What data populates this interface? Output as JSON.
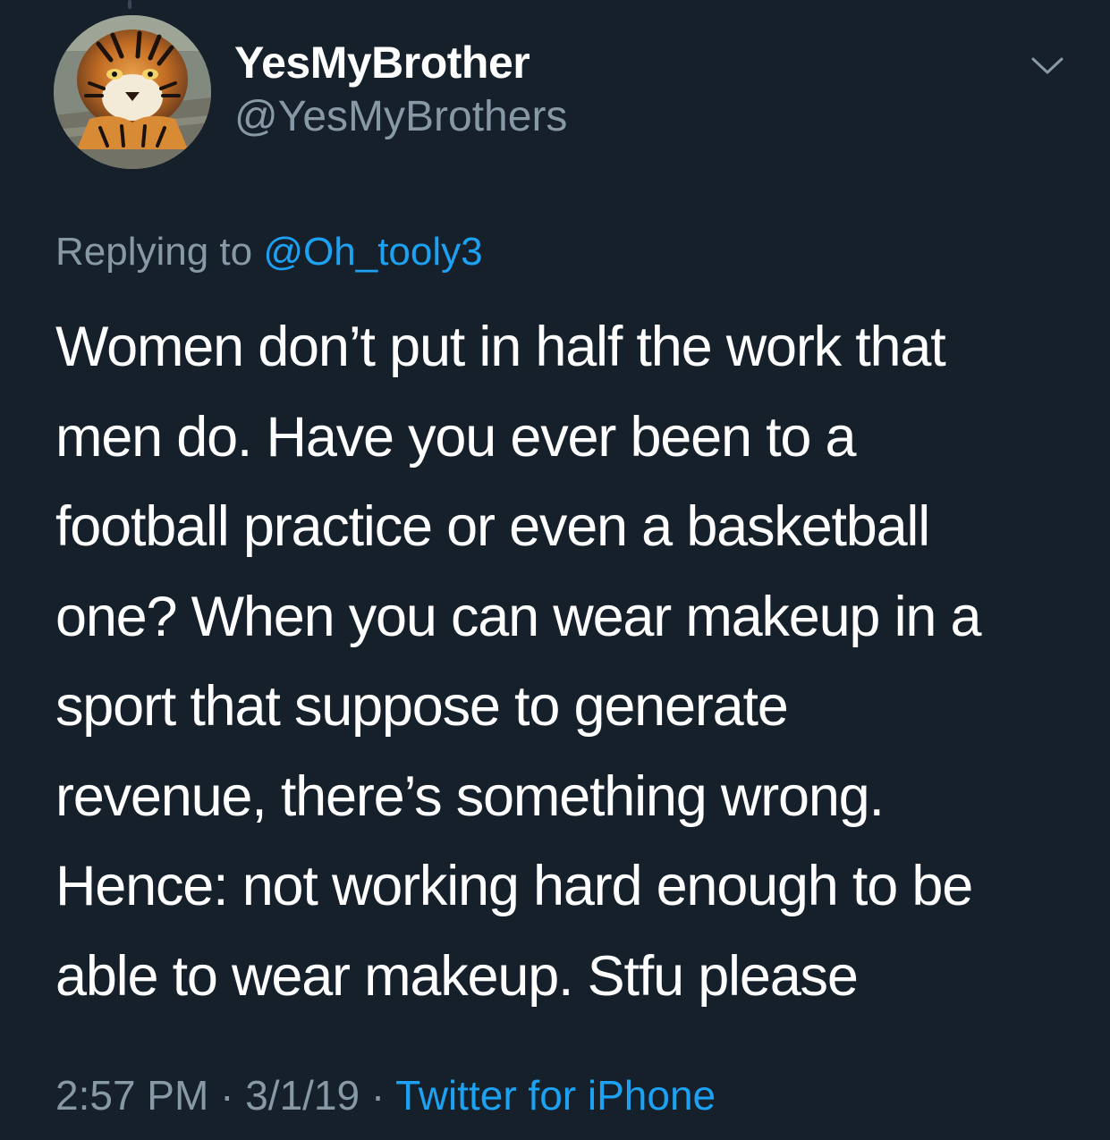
{
  "user": {
    "display_name": "YesMyBrother",
    "handle": "@YesMyBrothers",
    "avatar_icon": "tiger-avatar"
  },
  "reply": {
    "prefix": "Replying to",
    "mention": "@Oh_tooly3"
  },
  "tweet": {
    "lines": [
      "Women don’t put in half the work that",
      "men do. Have you ever been to a",
      "football practice or even a basketball",
      "one? When you can wear makeup in a",
      "sport that suppose to generate",
      "revenue, there’s something wrong.",
      "Hence: not working hard enough to be",
      "able to wear makeup. Stfu please"
    ]
  },
  "meta": {
    "time": "2:57 PM",
    "separator_1": " · ",
    "date": "3/1/19",
    "separator_2": " · ",
    "source": "Twitter for iPhone"
  },
  "icons": {
    "menu": "chevron-down-icon"
  },
  "colors": {
    "background": "#15202b",
    "text": "#ffffff",
    "secondary": "#8899a6",
    "link": "#1da1f2"
  }
}
